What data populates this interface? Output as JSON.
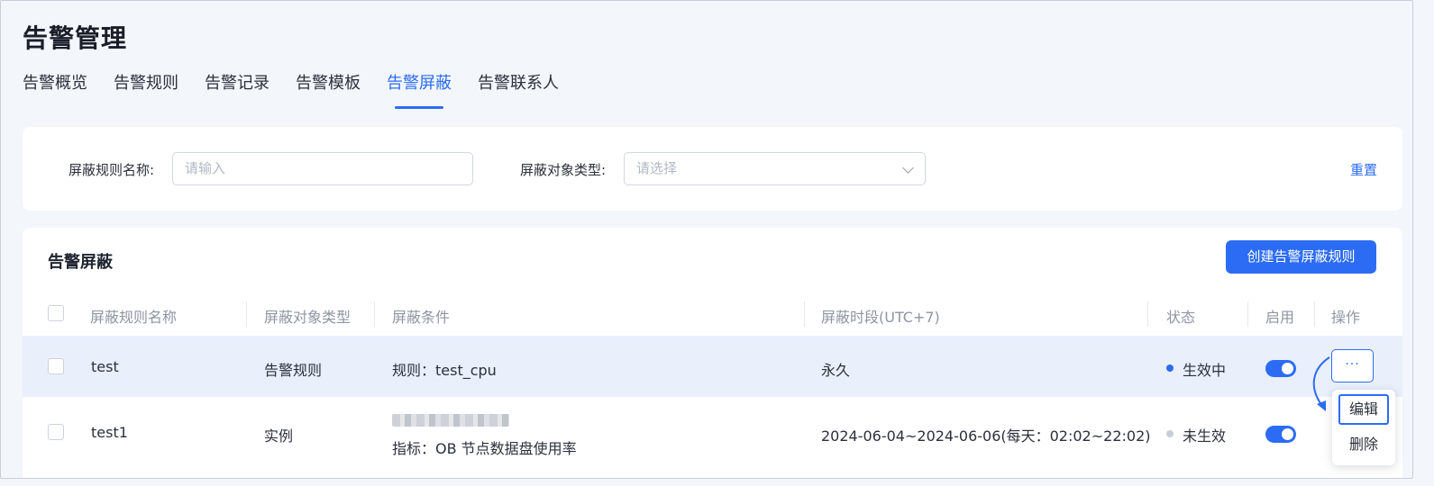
{
  "header": {
    "title": "告警管理"
  },
  "tabs": [
    {
      "label": "告警概览"
    },
    {
      "label": "告警规则"
    },
    {
      "label": "告警记录"
    },
    {
      "label": "告警模板"
    },
    {
      "label": "告警屏蔽",
      "active": true
    },
    {
      "label": "告警联系人"
    }
  ],
  "filters": {
    "name_label": "屏蔽规则名称:",
    "name_placeholder": "请输入",
    "type_label": "屏蔽对象类型:",
    "type_placeholder": "请选择",
    "reset_label": "重置"
  },
  "table_section": {
    "title": "告警屏蔽",
    "create_label": "创建告警屏蔽规则",
    "columns": [
      "屏蔽规则名称",
      "屏蔽对象类型",
      "屏蔽条件",
      "屏蔽时段(UTC+7)",
      "状态",
      "启用",
      "操作"
    ],
    "rows": [
      {
        "name": "test",
        "type": "告警规则",
        "condition": "规则：test_cpu",
        "period": "永久",
        "status": "生效中",
        "enabled": true
      },
      {
        "name": "test1",
        "type": "实例",
        "condition_line2": "指标：OB 节点数据盘使用率",
        "period": "2024-06-04~2024-06-06(每天：02:02~22:02)",
        "status": "未生效",
        "enabled": true
      }
    ],
    "more_label": "···",
    "menu": {
      "edit": "编辑",
      "delete": "删除"
    }
  },
  "colors": {
    "accent": "#2c6cf4",
    "active_dot": "#2c6cf4",
    "inactive_dot": "#c9cdd6"
  }
}
